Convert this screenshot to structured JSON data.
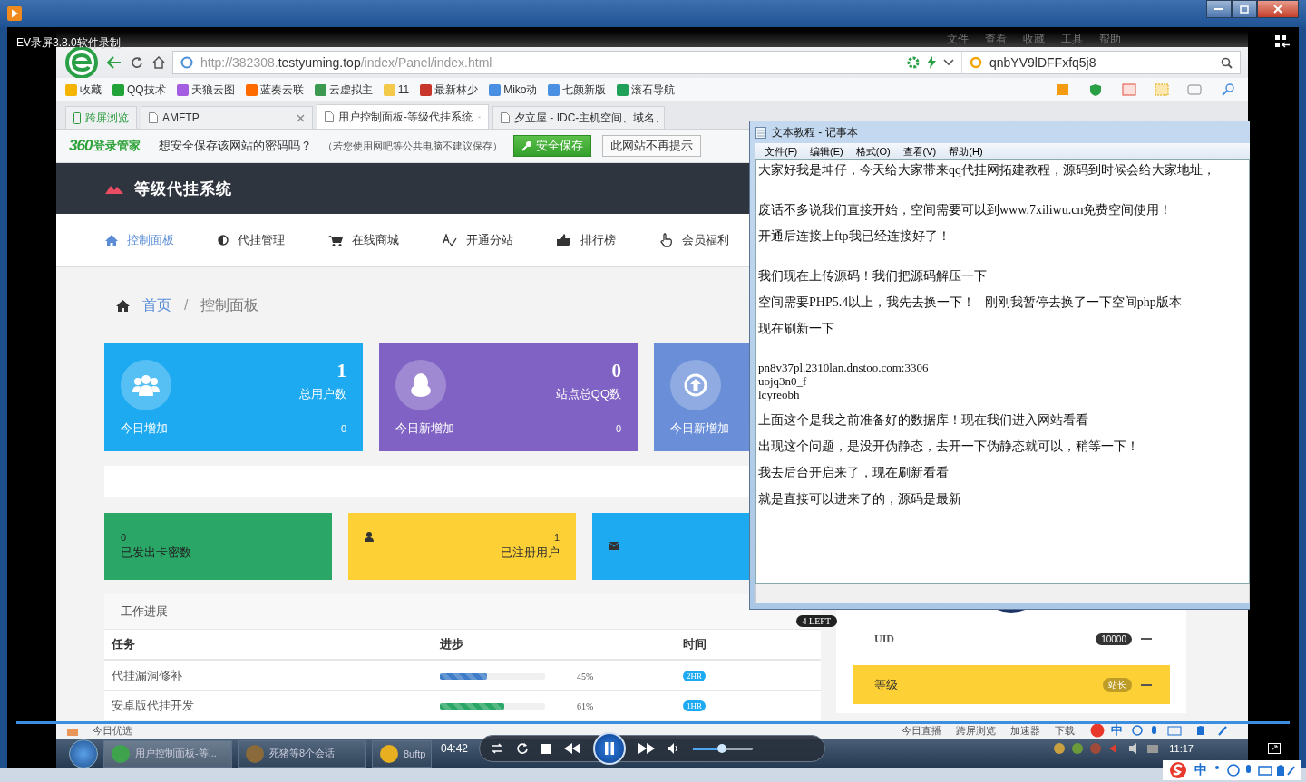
{
  "player": {
    "title": "EV录屏3.8.0软件录制",
    "time": "04:42",
    "playing": true,
    "volume": {
      "level": 0.48
    },
    "ime": {
      "label": "中"
    }
  },
  "browser": {
    "menu": [
      "文件",
      "查看",
      "收藏",
      "工具",
      "帮助"
    ],
    "address": {
      "scheme": "http://382308.",
      "domain": "testyuming.top",
      "path": "/index/Panel/index.html"
    },
    "search": {
      "value": "qnbYV9lDFFxfq5j8"
    },
    "bookmarks": [
      {
        "label": "收藏"
      },
      {
        "label": "QQ技术"
      },
      {
        "label": "天狼云图"
      },
      {
        "label": "蓝奏云联"
      },
      {
        "label": "云虚拟主"
      },
      {
        "label": "11"
      },
      {
        "label": "最新林少"
      },
      {
        "label": "Miko动"
      },
      {
        "label": "七颜新版"
      },
      {
        "label": "滚石导航"
      }
    ],
    "tabs": [
      {
        "label": "跨屏浏览",
        "kind": "pinned",
        "selected": false
      },
      {
        "label": "AMFTP",
        "kind": "page",
        "selected": false
      },
      {
        "label": "用户控制面板-等级代挂系统",
        "kind": "page",
        "selected": true
      },
      {
        "label": "夕立屋 - IDC-主机空间、域名、",
        "kind": "page",
        "selected": false
      }
    ],
    "password_bar": {
      "brand": "360",
      "product": "登录管家",
      "message": "想安全保存该网站的密码吗？",
      "note": "（若您使用网吧等公共电脑不建议保存）",
      "buttons": [
        "安全保存",
        "此网站不再提示"
      ]
    },
    "status_bar": {
      "left": "今日优选",
      "items": [
        "今日直播",
        "跨屏浏览",
        "加速器",
        "下载"
      ],
      "ime": "中"
    }
  },
  "site": {
    "title": "等级代挂系统",
    "nav": [
      {
        "label": "控制面板",
        "selected": true
      },
      {
        "label": "代挂管理",
        "selected": false
      },
      {
        "label": "在线商城",
        "selected": false
      },
      {
        "label": "开通分站",
        "selected": false
      },
      {
        "label": "排行榜",
        "selected": false
      },
      {
        "label": "会员福利",
        "selected": false
      }
    ],
    "breadcrumb": [
      "首页",
      "控制面板"
    ],
    "breadcrumb_separator": "/",
    "stats": [
      {
        "value": "1",
        "label": "总用户数",
        "footer": "今日增加",
        "footer_value": "0",
        "color": "#1eaaf1"
      },
      {
        "value": "0",
        "label": "站点总QQ数",
        "footer": "今日新增加",
        "footer_value": "0",
        "color": "#7f62c3"
      },
      {
        "footer": "今日新增加",
        "color": "#6a8fd8"
      }
    ],
    "tiles": [
      {
        "value": "0",
        "label": "已发出卡密数",
        "color": "#2aa667"
      },
      {
        "value": "1",
        "label": "已注册用户",
        "color": "#fdd135"
      },
      {
        "color": "#1eaaf1"
      }
    ],
    "progress": {
      "title": "工作进展",
      "badge": "4 LEFT",
      "columns": [
        "任务",
        "进步",
        "时间"
      ],
      "rows": [
        {
          "task": "代挂漏洞修补",
          "level": 0.45,
          "percent": "45%",
          "time": "2HR",
          "color": "#3f7dc8"
        },
        {
          "task": "安卓版代挂开发",
          "level": 0.61,
          "percent": "61%",
          "time": "1HR",
          "color": "#2aa667"
        }
      ]
    },
    "profile": [
      {
        "label": "UID",
        "value": "10000",
        "selected": false
      },
      {
        "label": "等级",
        "value": "站长",
        "selected": true
      }
    ]
  },
  "notepad": {
    "title": "文本教程 - 记事本",
    "menu": [
      "文件(F)",
      "编辑(E)",
      "格式(O)",
      "查看(V)",
      "帮助(H)"
    ],
    "lines": [
      {
        "kind": "text",
        "text": "大家好我是坤仔，今天给大家带来qq代挂网拓建教程，源码到时候会给大家地址，"
      },
      {
        "kind": "blank"
      },
      {
        "kind": "text",
        "text": "废话不多说我们直接开始，空间需要可以到www.7xiliwu.cn免费空间使用！"
      },
      {
        "kind": "text",
        "text": "开通后连接上ftp我已经连接好了！"
      },
      {
        "kind": "blank"
      },
      {
        "kind": "text",
        "text": "我们现在上传源码！我们把源码解压一下"
      },
      {
        "kind": "text",
        "text": "空间需要PHP5.4以上，我先去换一下！   刚刚我暂停去换了一下空间php版本"
      },
      {
        "kind": "text",
        "text": "现在刷新一下"
      },
      {
        "kind": "blank"
      },
      {
        "kind": "code",
        "text": "pn8v37pl.2310lan.dnstoo.com:3306"
      },
      {
        "kind": "code",
        "text": "uojq3n0_f"
      },
      {
        "kind": "code",
        "text": "lcyreobh"
      },
      {
        "kind": "text",
        "text": "上面这个是我之前准备好的数据库！现在我们进入网站看看"
      },
      {
        "kind": "text",
        "text": "出现这个问题，是没开伪静态，去开一下伪静态就可以，稍等一下！"
      },
      {
        "kind": "text",
        "text": "我去后台开启来了，现在刷新看看"
      },
      {
        "kind": "text",
        "text": "就是直接可以进来了的，源码是最新"
      }
    ]
  },
  "taskbar": {
    "items": [
      {
        "label": "用户控制面板-等...",
        "selected": true
      },
      {
        "label": "死猪等8个会话",
        "selected": false
      },
      {
        "label": "8uftp",
        "selected": false
      }
    ],
    "clock": "11:17"
  }
}
